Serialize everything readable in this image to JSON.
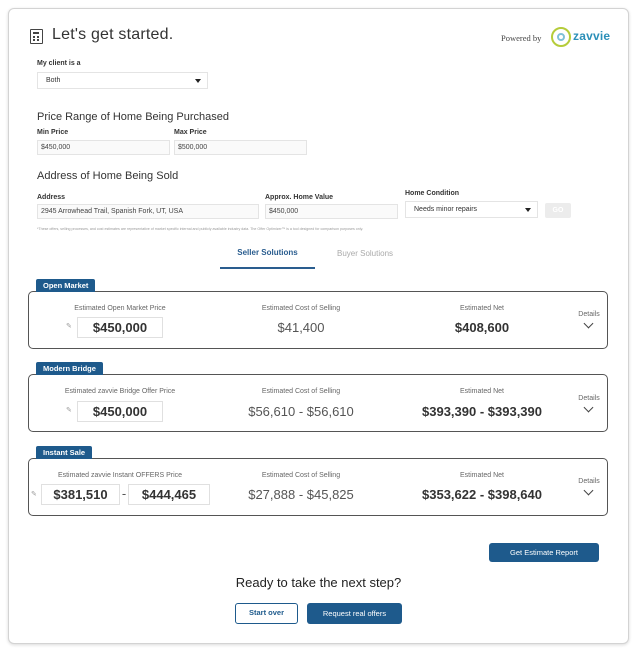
{
  "header": {
    "title": "Let's get started.",
    "powered_by": "Powered by",
    "brand": "zavvie"
  },
  "client": {
    "label": "My client is a",
    "value": "Both"
  },
  "price_range": {
    "heading": "Price Range of Home Being Purchased",
    "min_label": "Min Price",
    "min_value": "$450,000",
    "max_label": "Max Price",
    "max_value": "$500,000"
  },
  "address_section": {
    "heading": "Address of Home Being Sold",
    "address_label": "Address",
    "address_value": "2945 Arrowhead Trail, Spanish Fork, UT, USA",
    "value_label": "Approx. Home Value",
    "value_value": "$450,000",
    "condition_label": "Home Condition",
    "condition_value": "Needs minor repairs",
    "go_label": "GO"
  },
  "disclaimer": "*These offers, selling processes, and cost estimates are representative of market specific internal and publicly available industry data. The Offer Optimizer™ is a tool designed for comparison purposes only.",
  "tabs": {
    "seller": "Seller Solutions",
    "buyer": "Buyer Solutions"
  },
  "solutions": {
    "open_market": {
      "tag": "Open Market",
      "price_label": "Estimated Open Market Price",
      "price": "$450,000",
      "cost_label": "Estimated Cost of Selling",
      "cost": "$41,400",
      "net_label": "Estimated Net",
      "net": "$408,600",
      "details": "Details"
    },
    "modern_bridge": {
      "tag": "Modern Bridge",
      "price_label": "Estimated zavvie Bridge Offer Price",
      "price": "$450,000",
      "cost_label": "Estimated Cost of Selling",
      "cost": "$56,610 - $56,610",
      "net_label": "Estimated Net",
      "net": "$393,390 - $393,390",
      "details": "Details"
    },
    "instant_sale": {
      "tag": "Instant Sale",
      "price_label": "Estimated zavvie Instant OFFERS Price",
      "price_low": "$381,510",
      "price_sep": "-",
      "price_high": "$444,465",
      "cost_label": "Estimated Cost of Selling",
      "cost": "$27,888 - $45,825",
      "net_label": "Estimated Net",
      "net": "$353,622 - $398,640",
      "details": "Details"
    }
  },
  "actions": {
    "estimate_report": "Get Estimate Report",
    "cta": "Ready to take the next step?",
    "start_over": "Start over",
    "request_offers": "Request real offers"
  }
}
